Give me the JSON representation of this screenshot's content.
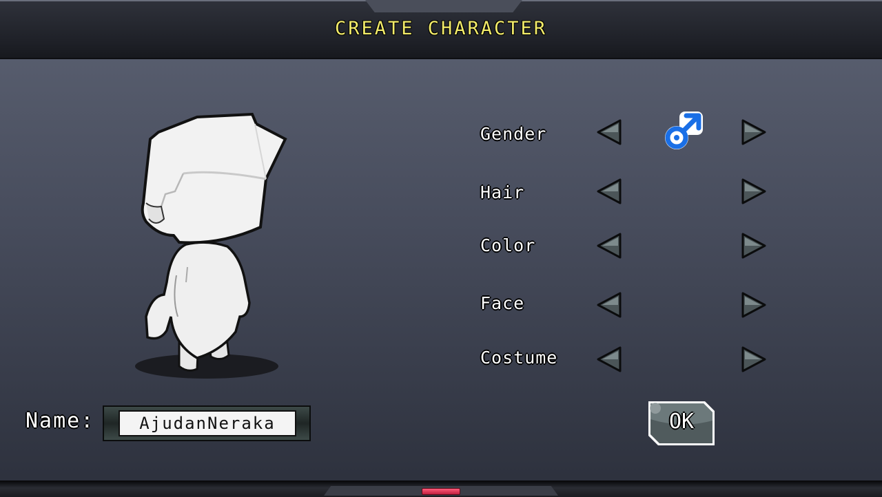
{
  "header": {
    "title": "CREATE CHARACTER"
  },
  "options": {
    "gender": {
      "label": "Gender",
      "value_icon": "male-symbol-icon"
    },
    "hair": {
      "label": "Hair"
    },
    "color": {
      "label": "Color"
    },
    "face": {
      "label": "Face"
    },
    "costume": {
      "label": "Costume"
    }
  },
  "name": {
    "label": "Name:",
    "value": "AjudanNeraka"
  },
  "ok_button": {
    "label": "OK"
  },
  "colors": {
    "title": "#f3ec6a",
    "gender_icon": "#1a6fe6",
    "arrow": "#4b5558",
    "footer_light": "#e8345a"
  }
}
